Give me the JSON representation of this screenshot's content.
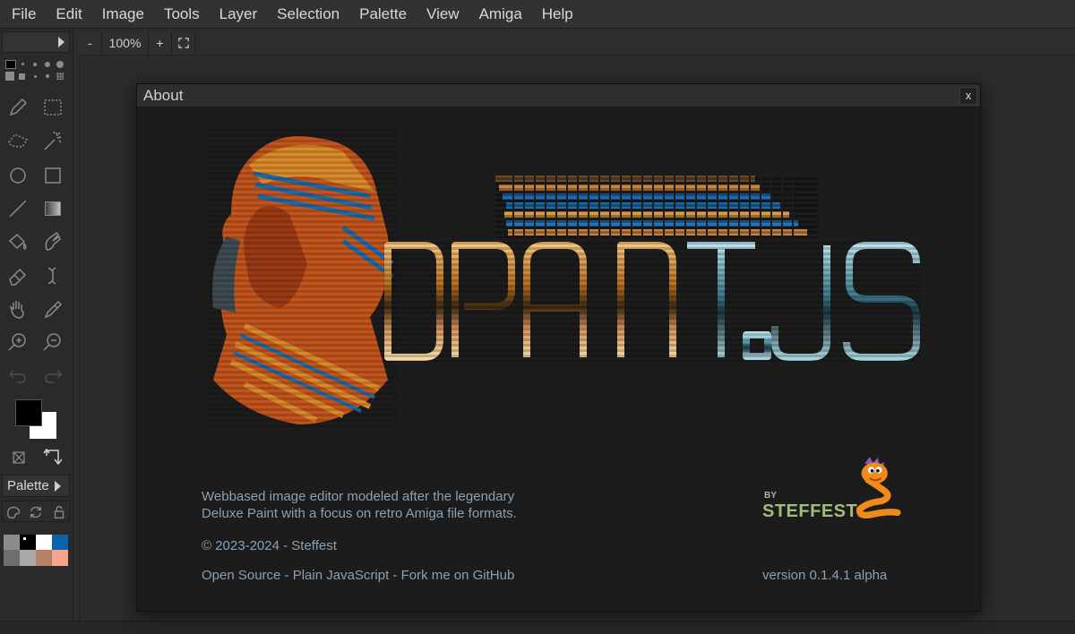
{
  "menu": [
    "File",
    "Edit",
    "Image",
    "Tools",
    "Layer",
    "Selection",
    "Palette",
    "View",
    "Amiga",
    "Help"
  ],
  "zoom": {
    "minus": "-",
    "level": "100%",
    "plus": "+"
  },
  "palette_panel": {
    "label": "Palette"
  },
  "palette_colors": [
    "#8c8c8c",
    "#000000",
    "#ffffff",
    "#0b64aa",
    "#6e6e6e",
    "#a8a8a8",
    "#b58064",
    "#f7a58a"
  ],
  "colors": {
    "foreground": "#000000",
    "background": "#ffffff"
  },
  "about": {
    "title": "About",
    "close": "x",
    "logo_text": "DPAINT.JS",
    "by_label": "BY",
    "author_logo": "STEFFEST",
    "description_line1": "Webbased image editor modeled after the legendary",
    "description_line2": "Deluxe Paint with a focus on retro Amiga file formats.",
    "copyright": "© 2023-2024 - Steffest",
    "links": "Open Source - Plain JavaScript - Fork me on GitHub",
    "version": "version 0.1.4.1 alpha"
  }
}
